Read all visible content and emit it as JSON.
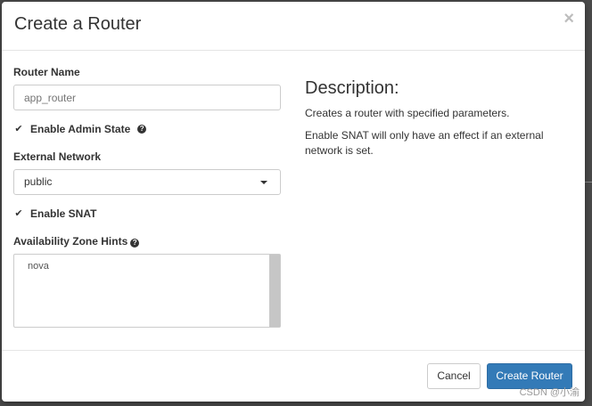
{
  "dialog": {
    "title": "Create a Router",
    "close_symbol": "×"
  },
  "form": {
    "router_name": {
      "label": "Router Name",
      "placeholder": "app_router"
    },
    "enable_admin_state": {
      "label": "Enable Admin State",
      "checked": true,
      "help_symbol": "?"
    },
    "external_network": {
      "label": "External Network",
      "selected": "public"
    },
    "enable_snat": {
      "label": "Enable SNAT",
      "checked": true
    },
    "availability_zone_hints": {
      "label": "Availability Zone Hints",
      "help_symbol": "?",
      "options": [
        "nova"
      ]
    }
  },
  "description": {
    "title": "Description:",
    "paragraphs": [
      "Creates a router with specified parameters.",
      "Enable SNAT will only have an effect if an external network is set."
    ]
  },
  "footer": {
    "cancel_label": "Cancel",
    "create_label": "Create Router"
  },
  "watermark": "CSDN @小渝",
  "icons": {
    "check": "check-icon",
    "help": "question-circle-icon",
    "close": "close-icon",
    "caret": "caret-down-icon"
  },
  "colors": {
    "primary_button": "#337ab7",
    "border": "#cccccc"
  }
}
